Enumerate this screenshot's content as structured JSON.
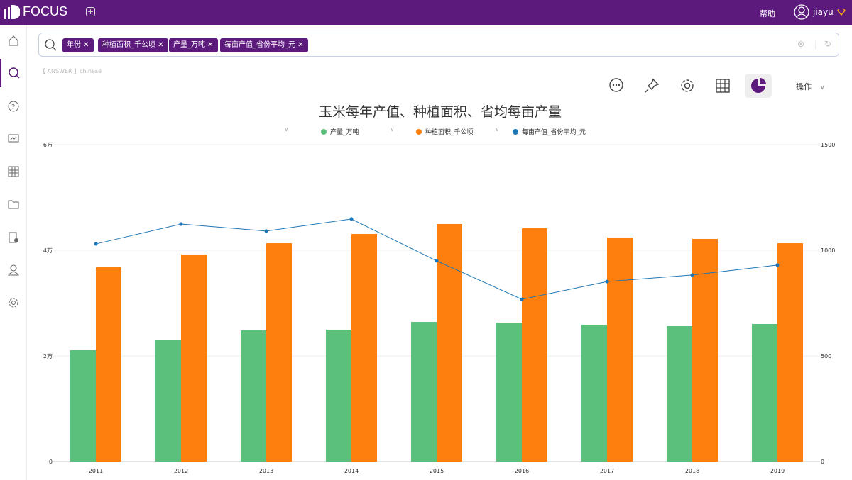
{
  "app": {
    "name": "FOCUS",
    "help": "帮助",
    "user": "jiayu"
  },
  "search": {
    "chips": [
      "年份",
      "种植面积_千公顷",
      "产量_万吨",
      "每亩产值_省份平均_元"
    ]
  },
  "answer_label": "【 ANSWER 】chinese",
  "toolbar": {
    "operate": "操作"
  },
  "colors": {
    "brand": "#5c1a7d",
    "green": "#5bc07c",
    "orange": "#ff7f0e",
    "blue": "#1f77b4"
  },
  "chart_data": {
    "type": "bar",
    "title": "玉米每年产值、种植面积、省均每亩产量",
    "categories": [
      "2011",
      "2012",
      "2013",
      "2014",
      "2015",
      "2016",
      "2017",
      "2018",
      "2019"
    ],
    "y_left": {
      "ticks": [
        "0",
        "2万",
        "4万",
        "6万"
      ],
      "range": [
        0,
        60000
      ]
    },
    "y_right": {
      "ticks": [
        "0",
        "500",
        "1000",
        "1500"
      ],
      "range": [
        0,
        1500
      ]
    },
    "series": [
      {
        "name": "产量_万吨",
        "type": "bar",
        "axis": "left",
        "color": "#5bc07c",
        "values": [
          21100,
          22950,
          24830,
          24970,
          26440,
          26310,
          25900,
          25640,
          26040
        ]
      },
      {
        "name": "种植面积_千公顷",
        "type": "bar",
        "axis": "left",
        "color": "#ff7f0e",
        "values": [
          36780,
          39200,
          41340,
          43090,
          44970,
          44160,
          42420,
          42150,
          41340
        ]
      },
      {
        "name": "每亩产值_省份平均_元",
        "type": "line",
        "axis": "right",
        "color": "#1f77b4",
        "values": [
          1030,
          1124,
          1091,
          1148,
          950,
          768,
          852,
          883,
          930
        ]
      }
    ],
    "legend": "top-center",
    "grid": true
  }
}
